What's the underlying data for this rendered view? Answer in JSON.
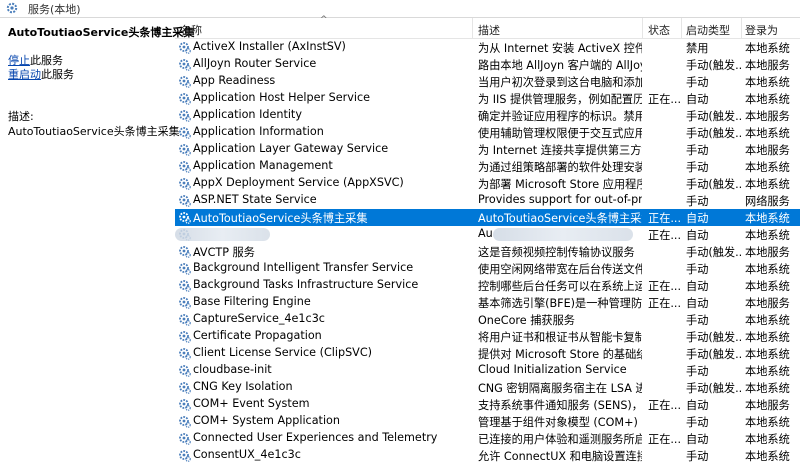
{
  "window": {
    "title": "服务(本地)"
  },
  "left_pane": {
    "service_name": "AutoToutiaoService头条博主采集",
    "actions": [
      {
        "link": "停止",
        "suffix": "此服务"
      },
      {
        "link": "重启动",
        "suffix": "此服务"
      }
    ],
    "description_label": "描述:",
    "description": "AutoToutiaoService头条博主采集"
  },
  "columns": {
    "name": "名称",
    "description": "描述",
    "status": "状态",
    "startup": "启动类型",
    "logon": "登录为"
  },
  "services": [
    {
      "name": "ActiveX Installer (AxInstSV)",
      "description": "为从 Internet 安装 ActiveX 控件提...",
      "status": "",
      "startup": "禁用",
      "logon": "本地系统"
    },
    {
      "name": "AllJoyn Router Service",
      "description": "路由本地 AllJoyn 客户端的 AllJoyn ...",
      "status": "",
      "startup": "手动(触发...",
      "logon": "本地服务"
    },
    {
      "name": "App Readiness",
      "description": "当用户初次登录到这台电脑和添加...",
      "status": "",
      "startup": "手动",
      "logon": "本地系统"
    },
    {
      "name": "Application Host Helper Service",
      "description": "为 IIS 提供管理服务，例如配置历...",
      "status": "正在...",
      "startup": "自动",
      "logon": "本地系统"
    },
    {
      "name": "Application Identity",
      "description": "确定并验证应用程序的标识。禁用...",
      "status": "",
      "startup": "手动(触发...",
      "logon": "本地服务"
    },
    {
      "name": "Application Information",
      "description": "使用辅助管理权限便于交互式应用...",
      "status": "",
      "startup": "手动(触发...",
      "logon": "本地系统"
    },
    {
      "name": "Application Layer Gateway Service",
      "description": "为 Internet 连接共享提供第三方协...",
      "status": "",
      "startup": "手动",
      "logon": "本地服务"
    },
    {
      "name": "Application Management",
      "description": "为通过组策略部署的软件处理安装...",
      "status": "",
      "startup": "手动",
      "logon": "本地系统"
    },
    {
      "name": "AppX Deployment Service (AppXSVC)",
      "description": "为部署 Microsoft Store 应用程序...",
      "status": "",
      "startup": "手动(触发...",
      "logon": "本地系统"
    },
    {
      "name": "ASP.NET State Service",
      "description": "Provides support for out-of-pro...",
      "status": "",
      "startup": "手动",
      "logon": "网络服务"
    },
    {
      "name": "AutoToutiaoService头条博主采集",
      "description": "AutoToutiaoService头条博主采集",
      "status": "正在...",
      "startup": "自动",
      "logon": "本地系统",
      "selected": true
    },
    {
      "name": "",
      "description": "Au",
      "status": "正在...",
      "startup": "自动",
      "logon": "本地系统",
      "redacted": true
    },
    {
      "name": "AVCTP 服务",
      "description": "这是音频视频控制传输协议服务",
      "status": "",
      "startup": "手动(触发...",
      "logon": "本地服务"
    },
    {
      "name": "Background Intelligent Transfer Service",
      "description": "使用空闲网络带宽在后台传送文件...",
      "status": "",
      "startup": "手动",
      "logon": "本地系统"
    },
    {
      "name": "Background Tasks Infrastructure Service",
      "description": "控制哪些后台任务可以在系统上运...",
      "status": "正在...",
      "startup": "自动",
      "logon": "本地系统"
    },
    {
      "name": "Base Filtering Engine",
      "description": "基本筛选引擎(BFE)是一种管理防火...",
      "status": "正在...",
      "startup": "自动",
      "logon": "本地服务"
    },
    {
      "name": "CaptureService_4e1c3c",
      "description": "OneCore 捕获服务",
      "status": "",
      "startup": "手动",
      "logon": "本地系统"
    },
    {
      "name": "Certificate Propagation",
      "description": "将用户证书和根证书从智能卡复制...",
      "status": "",
      "startup": "手动(触发...",
      "logon": "本地系统"
    },
    {
      "name": "Client License Service (ClipSVC)",
      "description": "提供对 Microsoft Store 的基础结...",
      "status": "",
      "startup": "手动(触发...",
      "logon": "本地系统"
    },
    {
      "name": "cloudbase-init",
      "description": "Cloud Initialization Service",
      "status": "",
      "startup": "手动",
      "logon": "本地系统"
    },
    {
      "name": "CNG Key Isolation",
      "description": "CNG 密钥隔离服务宿主在 LSA 进...",
      "status": "",
      "startup": "手动(触发...",
      "logon": "本地系统"
    },
    {
      "name": "COM+ Event System",
      "description": "支持系统事件通知服务 (SENS)，此...",
      "status": "正在...",
      "startup": "自动",
      "logon": "本地服务"
    },
    {
      "name": "COM+ System Application",
      "description": "管理基于组件对象模型 (COM+) 的...",
      "status": "",
      "startup": "手动",
      "logon": "本地系统"
    },
    {
      "name": "Connected User Experiences and Telemetry",
      "description": "已连接的用户体验和遥测服务所启...",
      "status": "正在...",
      "startup": "自动",
      "logon": "本地系统"
    },
    {
      "name": "ConsentUX_4e1c3c",
      "description": "允许 ConnectUX 和电脑设置连接...",
      "status": "",
      "startup": "手动",
      "logon": "本地系统"
    }
  ],
  "colors": {
    "selection": "#0078d7",
    "link": "#0645ad",
    "icon": "#4a7ebb"
  }
}
